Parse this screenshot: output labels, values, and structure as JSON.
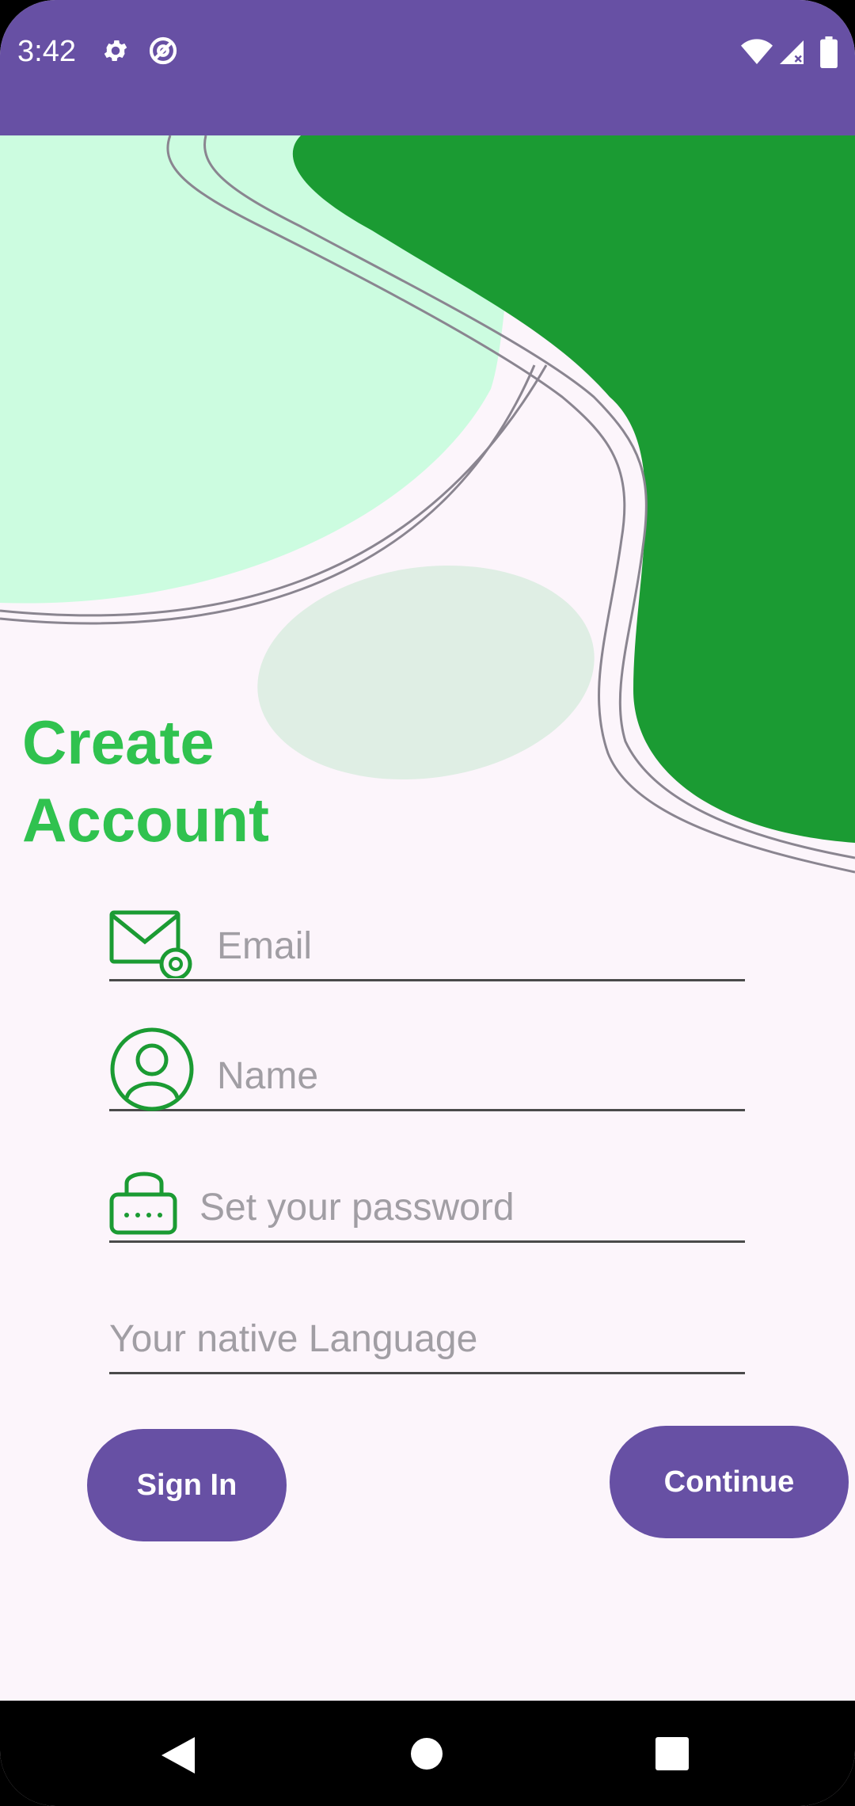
{
  "status_bar": {
    "time": "3:42",
    "left_icons": [
      "gear-icon",
      "at-sign-icon"
    ],
    "right_icons": [
      "wifi-icon",
      "signal-icon",
      "battery-icon"
    ],
    "color": "#6750a4"
  },
  "header": {
    "title": "Create Account",
    "title_color": "#30c24f"
  },
  "form": {
    "email": {
      "placeholder": "Email",
      "icon": "mail-at-icon"
    },
    "name": {
      "placeholder": "Name",
      "icon": "user-circle-icon"
    },
    "password": {
      "placeholder": "Set your password",
      "icon": "lock-icon"
    },
    "language": {
      "placeholder": "Your native Language"
    }
  },
  "actions": {
    "sign_in_label": "Sign In",
    "continue_label": "Continue",
    "button_color": "#6750a4"
  },
  "nav_bar": {
    "buttons": [
      "back-icon",
      "home-icon",
      "recents-icon"
    ]
  },
  "colors": {
    "dark_green": "#1b9b33",
    "mint": "#ccfce0",
    "pale_green": "#dfeee4",
    "background": "#fcf5fb"
  }
}
